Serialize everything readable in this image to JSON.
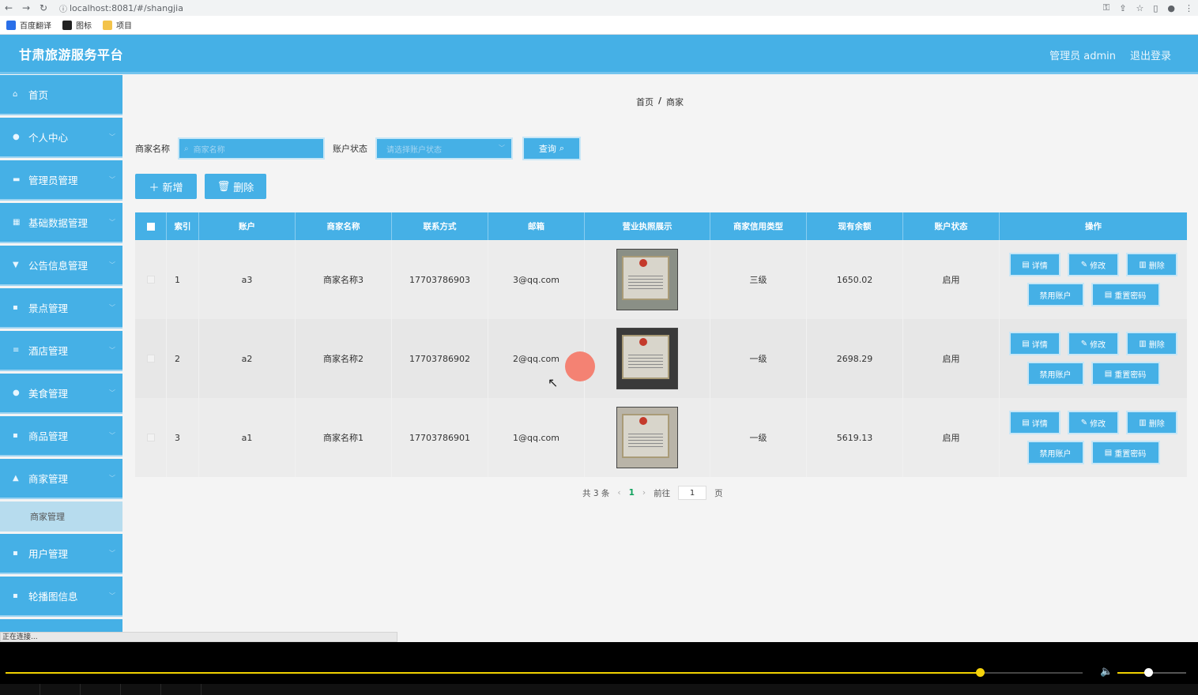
{
  "browser": {
    "url": "localhost:8081/#/shangjia",
    "bookmarks": [
      "百度翻译",
      "图标",
      "项目"
    ]
  },
  "header": {
    "title": "甘肃旅游服务平台",
    "user_label": "管理员 admin",
    "logout": "退出登录"
  },
  "sidebar": {
    "items": [
      {
        "label": "首页",
        "icon": "home-icon"
      },
      {
        "label": "个人中心",
        "icon": "user-icon"
      },
      {
        "label": "管理员管理",
        "icon": "admin-icon"
      },
      {
        "label": "基础数据管理",
        "icon": "data-icon"
      },
      {
        "label": "公告信息管理",
        "icon": "notice-icon"
      },
      {
        "label": "景点管理",
        "icon": "grid-icon"
      },
      {
        "label": "酒店管理",
        "icon": "list-icon"
      },
      {
        "label": "美食管理",
        "icon": "food-icon"
      },
      {
        "label": "商品管理",
        "icon": "grid-icon"
      },
      {
        "label": "商家管理",
        "icon": "thumb-icon"
      }
    ],
    "active_sub": "商家管理",
    "items_after": [
      {
        "label": "用户管理",
        "icon": "grid-icon"
      },
      {
        "label": "轮播图信息",
        "icon": "grid-icon"
      }
    ]
  },
  "breadcrumb": {
    "home": "首页",
    "sep": "/",
    "current": "商家"
  },
  "search": {
    "name_label": "商家名称",
    "name_placeholder": "商家名称",
    "status_label": "账户状态",
    "status_placeholder": "请选择账户状态",
    "query_label": "查询"
  },
  "actions": {
    "add": "新增",
    "delete": "删除"
  },
  "table": {
    "headers": [
      "索引",
      "账户",
      "商家名称",
      "联系方式",
      "邮箱",
      "营业执照展示",
      "商家信用类型",
      "现有余额",
      "账户状态",
      "操作"
    ],
    "rows": [
      {
        "index": "1",
        "account": "a3",
        "name": "商家名称3",
        "phone": "17703786903",
        "email": "3@qq.com",
        "credit": "三级",
        "balance": "1650.02",
        "status": "启用"
      },
      {
        "index": "2",
        "account": "a2",
        "name": "商家名称2",
        "phone": "17703786902",
        "email": "2@qq.com",
        "credit": "一级",
        "balance": "2698.29",
        "status": "启用"
      },
      {
        "index": "3",
        "account": "a1",
        "name": "商家名称1",
        "phone": "17703786901",
        "email": "1@qq.com",
        "credit": "一级",
        "balance": "5619.13",
        "status": "启用"
      }
    ],
    "ops": {
      "detail": "详情",
      "edit": "修改",
      "delete": "删除",
      "disable": "禁用账户",
      "reset": "重置密码"
    }
  },
  "pager": {
    "total": "共 3 条",
    "page": "1",
    "goto": "前往",
    "goto_value": "1",
    "suffix": "页"
  },
  "status_text": "正在连接...",
  "colors": {
    "primary": "#45b0e6",
    "active_page": "#0fa15c"
  }
}
